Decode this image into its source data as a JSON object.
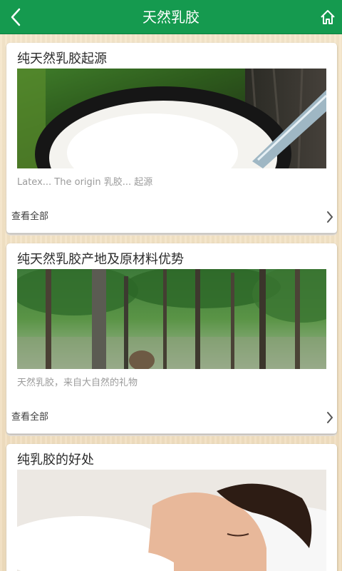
{
  "header": {
    "title": "天然乳胶",
    "back_icon": "chevron-left-icon",
    "home_icon": "home-icon",
    "color": "#159a4f"
  },
  "cards": [
    {
      "title": "纯天然乳胶起源",
      "image": "latex-tapping-cup-photo",
      "caption": "Latex... The origin 乳胶... 起源",
      "view_all": "查看全部"
    },
    {
      "title": "纯天然乳胶产地及原材料优势",
      "image": "rubber-tree-forest-photo",
      "caption": "天然乳胶，来自大自然的礼物",
      "view_all": "查看全部"
    },
    {
      "title": "纯乳胶的好处",
      "image": "girl-sleeping-on-pillow-photo"
    }
  ]
}
